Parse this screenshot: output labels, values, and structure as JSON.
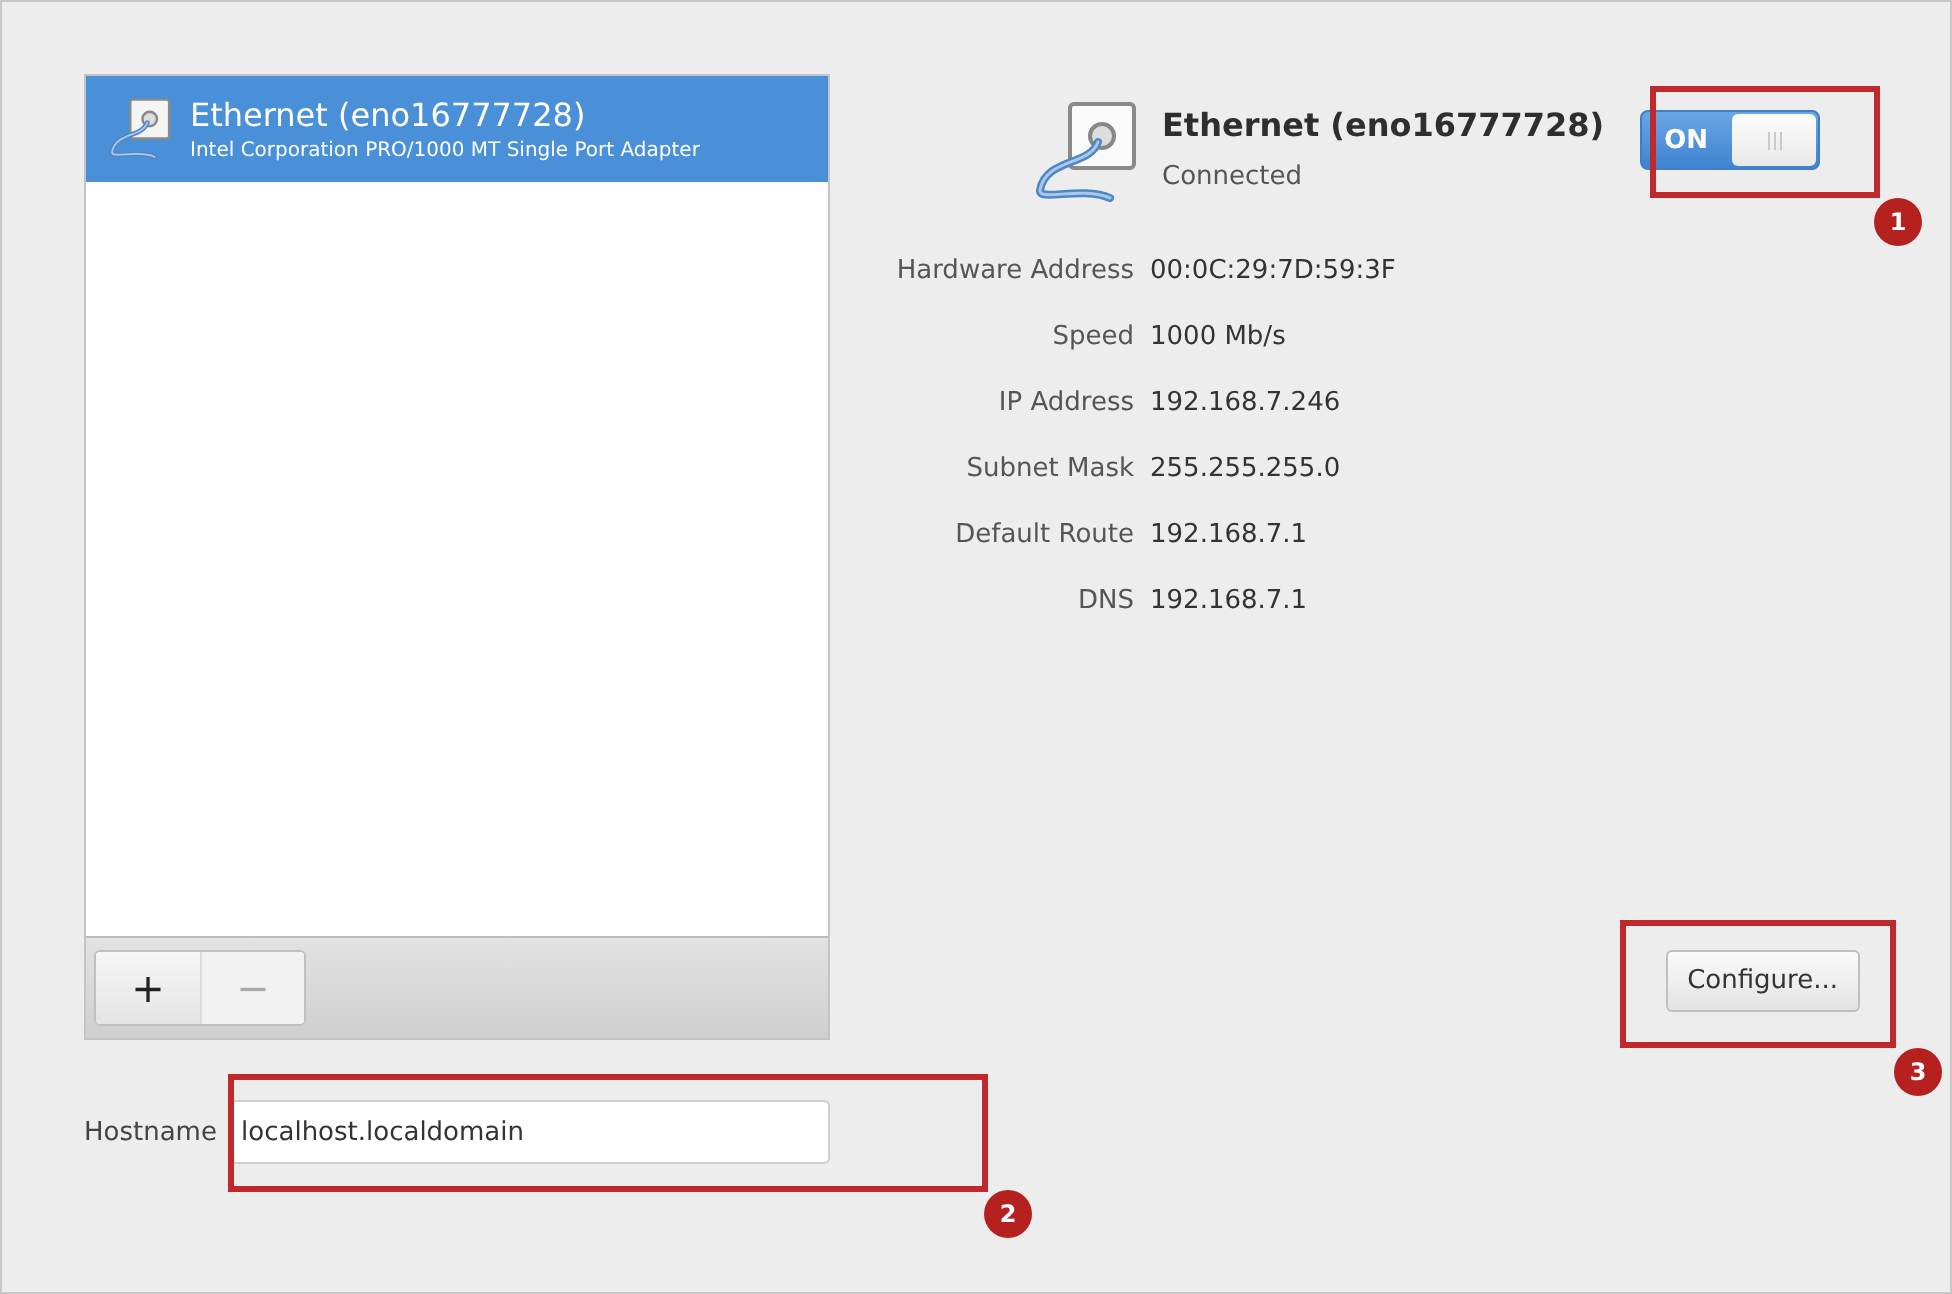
{
  "connections": [
    {
      "name": "Ethernet (eno16777728)",
      "description": "Intel Corporation PRO/1000 MT Single Port Adapter",
      "selected": true
    }
  ],
  "list_toolbar": {
    "buttons": [
      {
        "label": "+",
        "disabled": false
      },
      {
        "label": "−",
        "disabled": true
      }
    ]
  },
  "hostname": {
    "label": "Hostname",
    "value": "localhost.localdomain"
  },
  "details": {
    "title": "Ethernet (eno16777728)",
    "status": "Connected",
    "switch": {
      "label": "ON",
      "on": true
    },
    "fields": [
      {
        "label": "Hardware Address",
        "value": "00:0C:29:7D:59:3F"
      },
      {
        "label": "Speed",
        "value": "1000 Mb/s"
      },
      {
        "label": "IP Address",
        "value": "192.168.7.246"
      },
      {
        "label": "Subnet Mask",
        "value": "255.255.255.0"
      },
      {
        "label": "Default Route",
        "value": "192.168.7.1"
      },
      {
        "label": "DNS",
        "value": "192.168.7.1"
      }
    ],
    "configure_button": "Configure..."
  },
  "annotations": [
    {
      "number": "1",
      "kind": "switch"
    },
    {
      "number": "2",
      "kind": "hostname"
    },
    {
      "number": "3",
      "kind": "configure"
    }
  ]
}
